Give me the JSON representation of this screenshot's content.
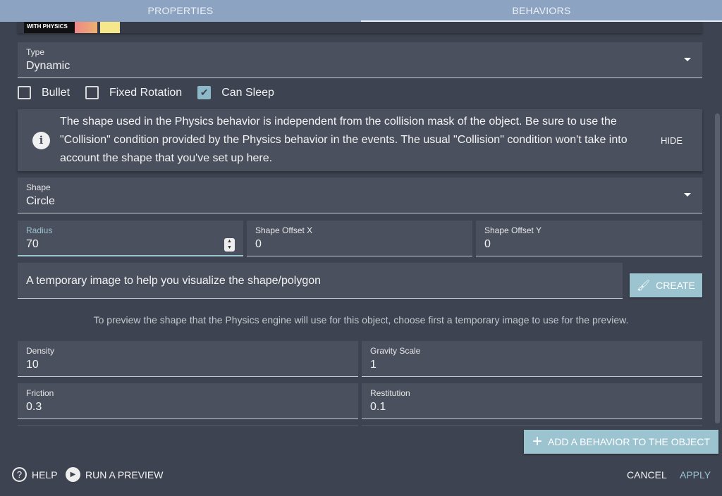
{
  "tabs": [
    "PROPERTIES",
    "BEHAVIORS"
  ],
  "thumbnail_text": "WITH PHYSICS",
  "type": {
    "label": "Type",
    "value": "Dynamic"
  },
  "checkboxes": [
    {
      "label": "Bullet",
      "checked": false
    },
    {
      "label": "Fixed Rotation",
      "checked": false
    },
    {
      "label": "Can Sleep",
      "checked": true
    }
  ],
  "info": {
    "text": "The shape used in the Physics behavior is independent from the collision mask of the object. Be sure to use the \"Collision\" condition provided by the Physics behavior in the events. The usual \"Collision\" condition won't take into account the shape that you've set up here.",
    "hide": "HIDE"
  },
  "shape": {
    "label": "Shape",
    "value": "Circle"
  },
  "radius": {
    "label": "Radius",
    "value": "70"
  },
  "offset_x": {
    "label": "Shape Offset X",
    "value": "0"
  },
  "offset_y": {
    "label": "Shape Offset Y",
    "value": "0"
  },
  "temp_image": {
    "placeholder": "A temporary image to help you visualize the shape/polygon",
    "create": "CREATE"
  },
  "hint": "To preview the shape that the Physics engine will use for this object, choose first a temporary image to use for the preview.",
  "density": {
    "label": "Density",
    "value": "10"
  },
  "gravity": {
    "label": "Gravity Scale",
    "value": "1"
  },
  "friction": {
    "label": "Friction",
    "value": "0.3"
  },
  "restitution": {
    "label": "Restitution",
    "value": "0.1"
  },
  "add_behavior": "ADD A BEHAVIOR TO THE OBJECT",
  "footer": {
    "help": "HELP",
    "preview": "RUN A PREVIEW",
    "cancel": "CANCEL",
    "apply": "APPLY"
  },
  "colors": {
    "accent": "#9bc3d0",
    "tabbar": "#8ca3c1",
    "background": "#3d4350",
    "field": "#4b505e"
  }
}
